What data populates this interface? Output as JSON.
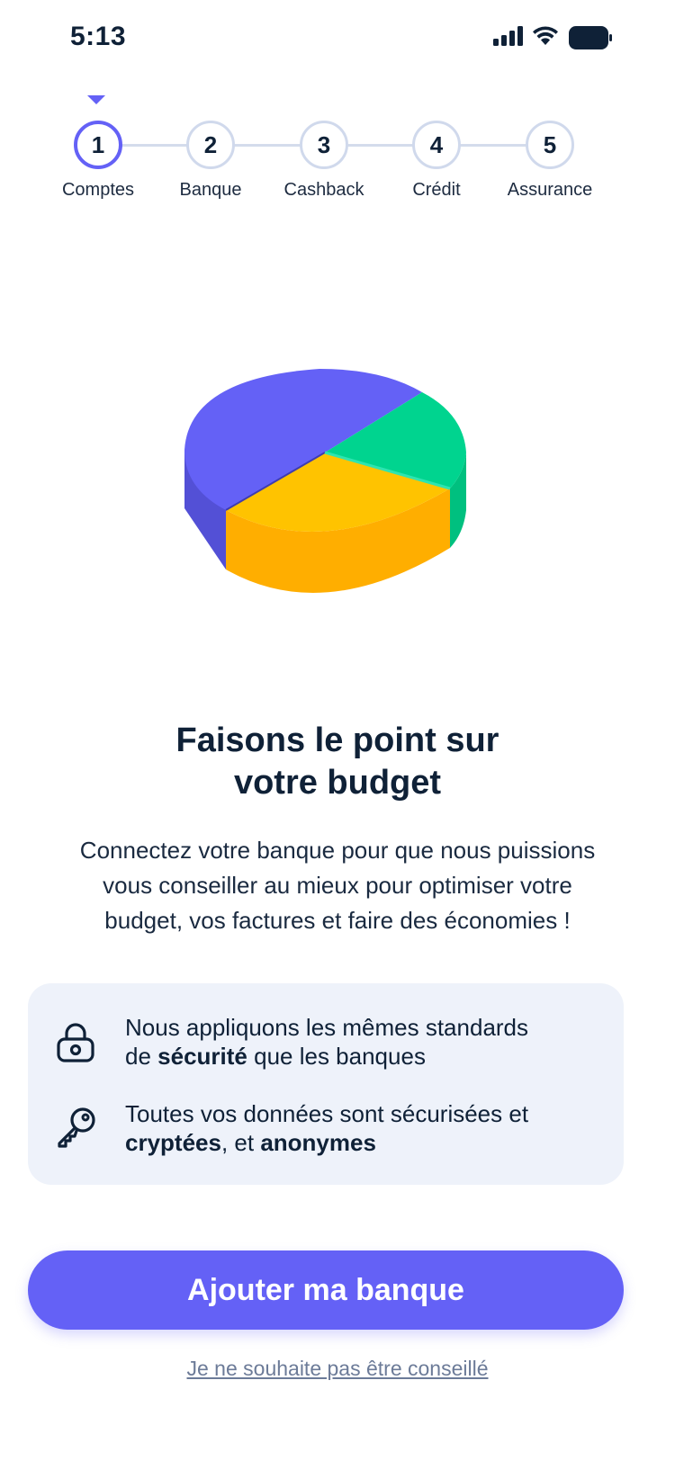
{
  "status_bar": {
    "time": "5:13"
  },
  "stepper": {
    "steps": [
      {
        "number": "1",
        "label": "Comptes"
      },
      {
        "number": "2",
        "label": "Banque"
      },
      {
        "number": "3",
        "label": "Cashback"
      },
      {
        "number": "4",
        "label": "Crédit"
      },
      {
        "number": "5",
        "label": "Assurance"
      }
    ]
  },
  "illustration": {
    "icon": "pie-chart-3d-icon",
    "colors": [
      "#6461f6",
      "#00d48f",
      "#ffc300"
    ]
  },
  "main": {
    "title_line1": "Faisons le point sur",
    "title_line2": "votre budget",
    "desc_line1": "Connectez votre banque pour que nous puissions",
    "desc_line2": "vous conseiller au mieux pour optimiser votre",
    "desc_line3": "budget, vos factures et faire des économies !"
  },
  "info_card": {
    "security": {
      "icon": "lock-icon",
      "line1": "Nous appliquons les mêmes standards",
      "prefix": "de ",
      "bold": "sécurité",
      "suffix": " que les banques"
    },
    "privacy": {
      "icon": "key-icon",
      "line1": "Toutes vos données sont sécurisées et",
      "bold1": "cryptées",
      "middle": ", et ",
      "bold2": "anonymes"
    }
  },
  "actions": {
    "add_bank_label": "Ajouter ma banque",
    "skip_label": "Je ne souhaite pas être conseillé"
  },
  "colors": {
    "accent": "#6461f6",
    "text": "#0f2137",
    "card_bg": "#eef2fa"
  }
}
